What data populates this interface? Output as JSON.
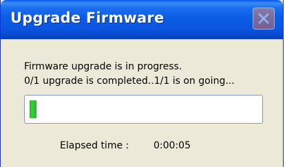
{
  "window": {
    "title": "Upgrade Firmware"
  },
  "message": {
    "line1": "Firmware upgrade is in progress.",
    "line2": "0/1 upgrade is completed..1/1 is on going..."
  },
  "progress": {
    "value_fraction": 0.03
  },
  "elapsed": {
    "label": "Elapsed time :",
    "value": "0:00:05"
  },
  "colors": {
    "titlebar": "#0b5ce6",
    "dialog_bg": "#ece9d8",
    "progress_fill": "#36d236",
    "close_button": "#d9795f"
  },
  "icons": {
    "close": "close-icon"
  }
}
